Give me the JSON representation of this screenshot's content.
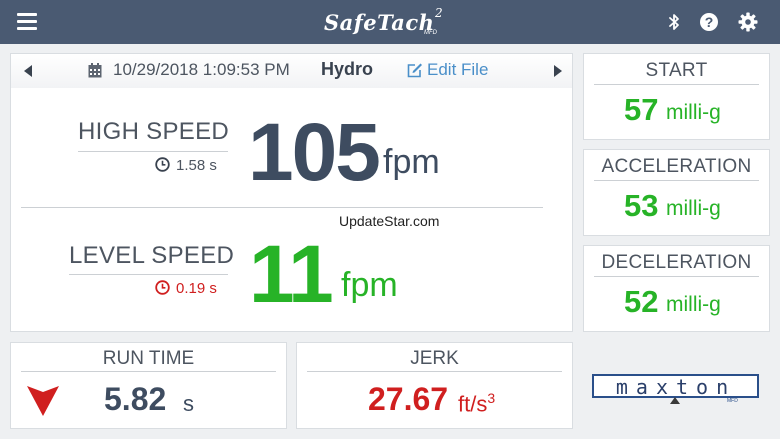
{
  "app": {
    "logo_word": "SafeTach",
    "logo_sup": "2",
    "logo_mfd": "MFD"
  },
  "toolbar": {
    "menu_icon": "hamburger-menu-icon",
    "bluetooth_icon": "bluetooth-icon",
    "help_icon": "help-circle-icon",
    "settings_icon": "gear-icon"
  },
  "record": {
    "datetime": "10/29/2018 1:09:53 PM",
    "file_name": "Hydro",
    "edit_label": "Edit File"
  },
  "high_speed": {
    "label": "HIGH SPEED",
    "time": "1.58 s",
    "value": "105",
    "unit": "fpm"
  },
  "level_speed": {
    "label": "LEVEL SPEED",
    "time": "0.19 s",
    "value": "11",
    "unit": "fpm"
  },
  "watermark": "UpdateStar.com",
  "metrics": {
    "start": {
      "label": "START",
      "value": "57",
      "unit": "milli-g"
    },
    "acceleration": {
      "label": "ACCELERATION",
      "value": "53",
      "unit": "milli-g"
    },
    "deceleration": {
      "label": "DECELERATION",
      "value": "52",
      "unit": "milli-g"
    }
  },
  "run_time": {
    "label": "RUN TIME",
    "value": "5.82",
    "unit": "s",
    "direction": "down"
  },
  "jerk": {
    "label": "JERK",
    "value": "27.67",
    "unit": "ft/s",
    "unit_sup": "3"
  },
  "brand": {
    "name": "maxton",
    "sub": "MFD"
  },
  "colors": {
    "header": "#4a5a72",
    "green": "#27b327",
    "red": "#d01f1f",
    "dark": "#39424f",
    "link": "#4a8fc9"
  }
}
